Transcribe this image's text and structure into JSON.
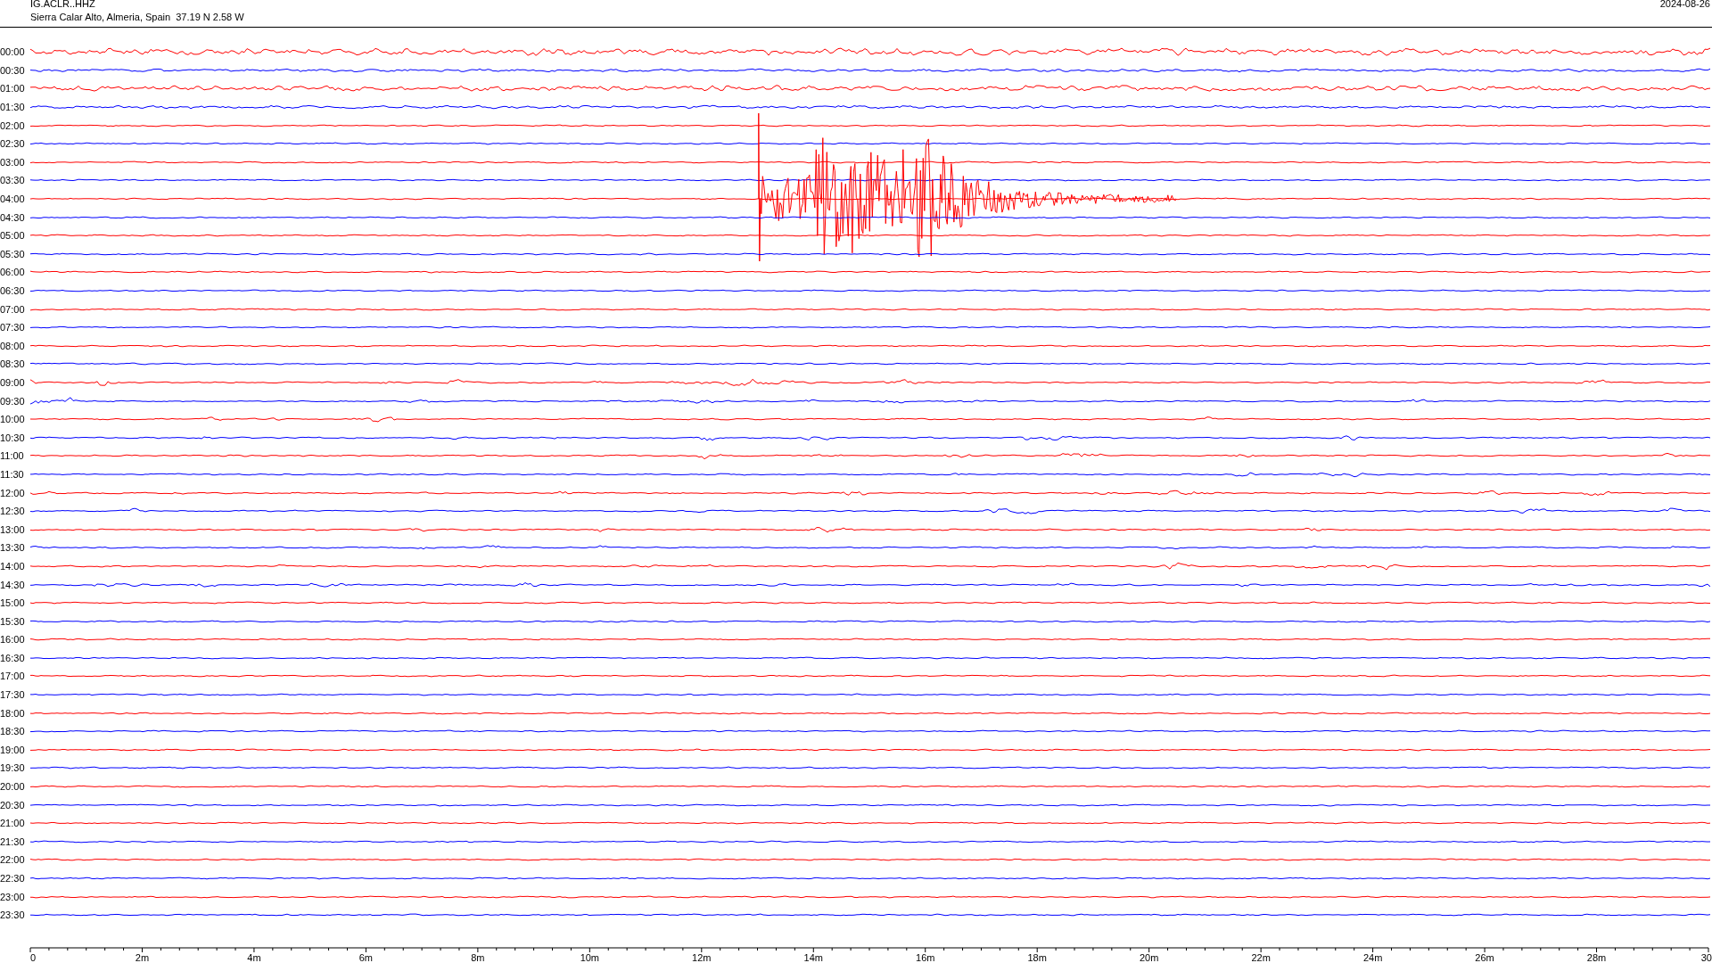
{
  "header": {
    "station": "IG.ACLR..HHZ",
    "location": "Sierra Calar Alto, Almeria, Spain  37.19 N 2.58 W",
    "date": "2024-08-26"
  },
  "traces": [
    {
      "time": "00:00",
      "color": "#ff0000"
    },
    {
      "time": "00:30",
      "color": "#0000ff"
    },
    {
      "time": "01:00",
      "color": "#ff0000"
    },
    {
      "time": "01:30",
      "color": "#0000ff"
    },
    {
      "time": "02:00",
      "color": "#ff0000"
    },
    {
      "time": "02:30",
      "color": "#0000ff"
    },
    {
      "time": "03:00",
      "color": "#ff0000"
    },
    {
      "time": "03:30",
      "color": "#0000ff"
    },
    {
      "time": "04:00",
      "color": "#ff0000"
    },
    {
      "time": "04:30",
      "color": "#0000ff"
    },
    {
      "time": "05:00",
      "color": "#ff0000"
    },
    {
      "time": "05:30",
      "color": "#0000ff"
    },
    {
      "time": "06:00",
      "color": "#ff0000"
    },
    {
      "time": "06:30",
      "color": "#0000ff"
    },
    {
      "time": "07:00",
      "color": "#ff0000"
    },
    {
      "time": "07:30",
      "color": "#0000ff"
    },
    {
      "time": "08:00",
      "color": "#ff0000"
    },
    {
      "time": "08:30",
      "color": "#0000ff"
    },
    {
      "time": "09:00",
      "color": "#ff0000"
    },
    {
      "time": "09:30",
      "color": "#0000ff"
    },
    {
      "time": "10:00",
      "color": "#ff0000"
    },
    {
      "time": "10:30",
      "color": "#0000ff"
    },
    {
      "time": "11:00",
      "color": "#ff0000"
    },
    {
      "time": "11:30",
      "color": "#0000ff"
    },
    {
      "time": "12:00",
      "color": "#ff0000"
    },
    {
      "time": "12:30",
      "color": "#0000ff"
    },
    {
      "time": "13:00",
      "color": "#ff0000"
    },
    {
      "time": "13:30",
      "color": "#0000ff"
    },
    {
      "time": "14:00",
      "color": "#ff0000"
    },
    {
      "time": "14:30",
      "color": "#0000ff"
    },
    {
      "time": "15:00",
      "color": "#ff0000"
    },
    {
      "time": "15:30",
      "color": "#0000ff"
    },
    {
      "time": "16:00",
      "color": "#ff0000"
    },
    {
      "time": "16:30",
      "color": "#0000ff"
    },
    {
      "time": "17:00",
      "color": "#ff0000"
    },
    {
      "time": "17:30",
      "color": "#0000ff"
    },
    {
      "time": "18:00",
      "color": "#ff0000"
    },
    {
      "time": "18:30",
      "color": "#0000ff"
    },
    {
      "time": "19:00",
      "color": "#ff0000"
    },
    {
      "time": "19:30",
      "color": "#0000ff"
    },
    {
      "time": "20:00",
      "color": "#ff0000"
    },
    {
      "time": "20:30",
      "color": "#0000ff"
    },
    {
      "time": "21:00",
      "color": "#ff0000"
    },
    {
      "time": "21:30",
      "color": "#0000ff"
    },
    {
      "time": "22:00",
      "color": "#ff0000"
    },
    {
      "time": "22:30",
      "color": "#0000ff"
    },
    {
      "time": "23:00",
      "color": "#ff0000"
    },
    {
      "time": "23:30",
      "color": "#0000ff"
    }
  ],
  "x_axis": {
    "ticks": [
      "0",
      "2m",
      "4m",
      "6m",
      "8m",
      "10m",
      "12m",
      "14m",
      "16m",
      "18m",
      "20m",
      "22m",
      "24m",
      "26m",
      "28m",
      "30"
    ]
  }
}
